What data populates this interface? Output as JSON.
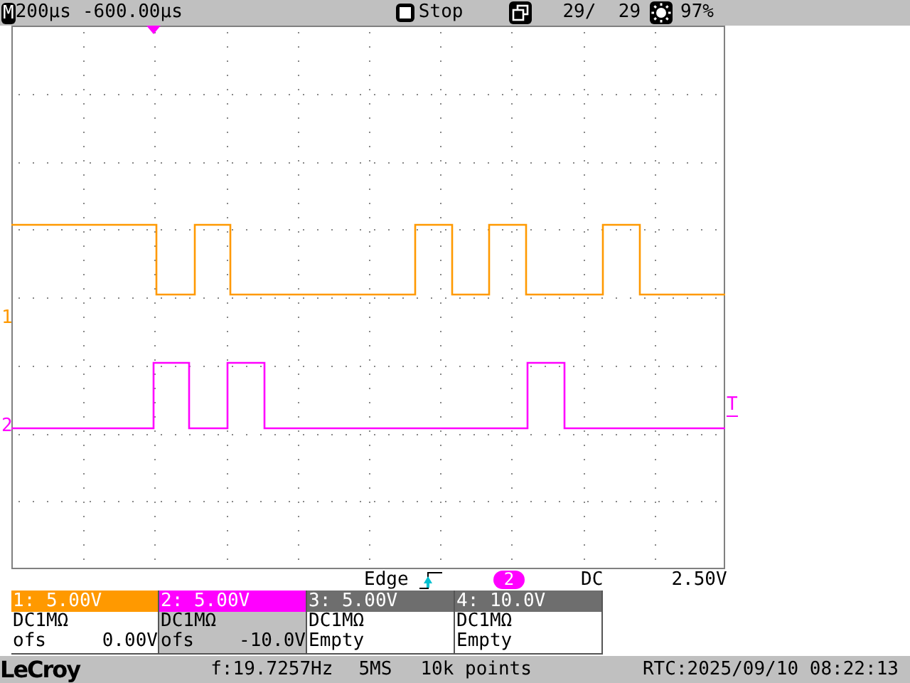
{
  "top_bar": {
    "mode_badge": "M",
    "timebase": "200µs",
    "delay": "-600.00µs",
    "run_state": "Stop",
    "acquisitions": "29/  29",
    "brightness": "97%"
  },
  "waveform_area": {
    "markers": [
      {
        "label": "1",
        "color": "#ff9900"
      },
      {
        "label": "2",
        "color": "#ff00ff"
      }
    ],
    "trigger_level_label": "T"
  },
  "trigger": {
    "type": "Edge",
    "source": "2",
    "coupling": "DC",
    "level": "2.50V"
  },
  "channels": [
    {
      "header": "1: 5.00V",
      "color": "#ff9900",
      "coupling": "DC1MΩ",
      "offset_label": "ofs",
      "offset": "0.00V",
      "selected": false
    },
    {
      "header": "2: 5.00V",
      "color": "#ff00ff",
      "coupling": "DC1MΩ",
      "offset_label": "ofs",
      "offset": "-10.0V",
      "selected": true
    },
    {
      "header": "3: 5.00V",
      "color": "#6e6e6e",
      "coupling": "DC1MΩ",
      "status": "Empty",
      "selected": false
    },
    {
      "header": "4: 10.0V",
      "color": "#6e6e6e",
      "coupling": "DC1MΩ",
      "status": "Empty",
      "selected": false
    }
  ],
  "status_bar": {
    "logo": "LeCroy",
    "frequency": "f:19.7257Hz",
    "sample_rate": "5MS",
    "record_length": "10k points",
    "clock": "RTC:2025/09/10 08:22:13"
  }
}
